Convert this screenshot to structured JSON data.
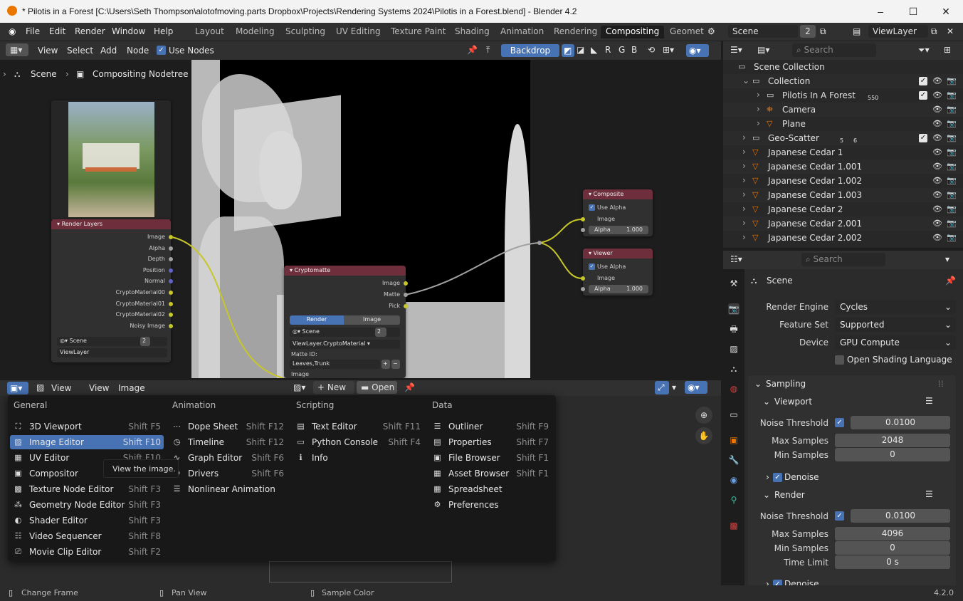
{
  "window": {
    "title": "* Pilotis in a Forest [C:\\Users\\Seth Thompson\\alotofmoving.parts Dropbox\\Projects\\Rendering Systems 2024\\Pilotis in a Forest.blend] - Blender 4.2",
    "minimize": "–",
    "maximize": "☐",
    "close": "✕"
  },
  "menu": [
    "File",
    "Edit",
    "Render",
    "Window",
    "Help"
  ],
  "workspaces": [
    "Layout",
    "Modeling",
    "Sculpting",
    "UV Editing",
    "Texture Paint",
    "Shading",
    "Animation",
    "Rendering",
    "Compositing",
    "Geomet"
  ],
  "scene": {
    "name": "Scene",
    "users": "2",
    "view_layer": "ViewLayer"
  },
  "node_header": {
    "view": "View",
    "select": "Select",
    "add": "Add",
    "node": "Node",
    "use_nodes": "Use Nodes",
    "backdrop": "Backdrop",
    "channels": [
      "R",
      "G",
      "B"
    ]
  },
  "breadcrumb": {
    "scene": "Scene",
    "tree": "Compositing Nodetree"
  },
  "render_layers": {
    "title": "Render Layers",
    "outputs": [
      "Image",
      "Alpha",
      "Depth",
      "Position",
      "Normal",
      "CryptoMaterial00",
      "CryptoMaterial01",
      "CryptoMaterial02",
      "Noisy Image"
    ],
    "scene": "Scene",
    "scene_users": "2",
    "layer": "ViewLayer"
  },
  "cryptomatte": {
    "title": "Cryptomatte",
    "outputs": [
      "Image",
      "Matte",
      "Pick"
    ],
    "tabs": [
      "Render",
      "Image"
    ],
    "scene": "Scene",
    "scene_users": "2",
    "layer": "ViewLayer.CryptoMaterial",
    "matte_label": "Matte ID:",
    "matte_value": "Leaves,Trunk",
    "input_image": "Image"
  },
  "composite": {
    "title": "Composite",
    "use_alpha": "Use Alpha",
    "image": "Image",
    "alpha": "Alpha",
    "alpha_value": "1.000"
  },
  "viewer": {
    "title": "Viewer",
    "use_alpha": "Use Alpha",
    "image": "Image",
    "alpha": "Alpha",
    "alpha_value": "1.000"
  },
  "image_header": {
    "view1": "View",
    "view2": "View",
    "image": "Image",
    "new": "New",
    "open": "Open"
  },
  "editor_menu": {
    "general": {
      "title": "General",
      "items": [
        {
          "label": "3D Viewport",
          "shortcut": "Shift F5"
        },
        {
          "label": "Image Editor",
          "shortcut": "Shift F10"
        },
        {
          "label": "UV Editor",
          "shortcut": "Shift F10"
        },
        {
          "label": "Compositor",
          "shortcut": ""
        },
        {
          "label": "Texture Node Editor",
          "shortcut": "Shift F3"
        },
        {
          "label": "Geometry Node Editor",
          "shortcut": "Shift F3"
        },
        {
          "label": "Shader Editor",
          "shortcut": "Shift F3"
        },
        {
          "label": "Video Sequencer",
          "shortcut": "Shift F8"
        },
        {
          "label": "Movie Clip Editor",
          "shortcut": "Shift F2"
        }
      ]
    },
    "animation": {
      "title": "Animation",
      "items": [
        {
          "label": "Dope Sheet",
          "shortcut": "Shift F12"
        },
        {
          "label": "Timeline",
          "shortcut": "Shift F12"
        },
        {
          "label": "Graph Editor",
          "shortcut": "Shift F6"
        },
        {
          "label": "Drivers",
          "shortcut": "Shift F6"
        },
        {
          "label": "Nonlinear Animation",
          "shortcut": ""
        }
      ]
    },
    "scripting": {
      "title": "Scripting",
      "items": [
        {
          "label": "Text Editor",
          "shortcut": "Shift F11"
        },
        {
          "label": "Python Console",
          "shortcut": "Shift F4"
        },
        {
          "label": "Info",
          "shortcut": ""
        }
      ]
    },
    "data": {
      "title": "Data",
      "items": [
        {
          "label": "Outliner",
          "shortcut": "Shift F9"
        },
        {
          "label": "Properties",
          "shortcut": "Shift F7"
        },
        {
          "label": "File Browser",
          "shortcut": "Shift F1"
        },
        {
          "label": "Asset Browser",
          "shortcut": "Shift F1"
        },
        {
          "label": "Spreadsheet",
          "shortcut": ""
        },
        {
          "label": "Preferences",
          "shortcut": ""
        }
      ]
    },
    "tooltip": "View the image."
  },
  "outliner": {
    "search": "Search",
    "rows": [
      {
        "label": "Scene Collection",
        "icon": "collection"
      },
      {
        "label": "Collection",
        "icon": "collection"
      },
      {
        "label": "Pilotis In A Forest",
        "icon": "collection",
        "badge": "550"
      },
      {
        "label": "Camera",
        "icon": "camera"
      },
      {
        "label": "Plane",
        "icon": "mesh"
      },
      {
        "label": "Geo-Scatter",
        "icon": "collection",
        "badge": "5",
        "badge2": "6"
      },
      {
        "label": "Japanese Cedar 1",
        "icon": "mesh"
      },
      {
        "label": "Japanese Cedar 1.001",
        "icon": "mesh"
      },
      {
        "label": "Japanese Cedar 1.002",
        "icon": "mesh"
      },
      {
        "label": "Japanese Cedar 1.003",
        "icon": "mesh"
      },
      {
        "label": "Japanese Cedar 2",
        "icon": "mesh"
      },
      {
        "label": "Japanese Cedar 2.001",
        "icon": "mesh"
      },
      {
        "label": "Japanese Cedar 2.002",
        "icon": "mesh"
      }
    ]
  },
  "properties": {
    "search": "Search",
    "context": "Scene",
    "render_engine_label": "Render Engine",
    "render_engine": "Cycles",
    "feature_set_label": "Feature Set",
    "feature_set": "Supported",
    "device_label": "Device",
    "device": "GPU Compute",
    "osl": "Open Shading Language",
    "sampling": "Sampling",
    "viewport": "Viewport",
    "noise_threshold_label": "Noise Threshold",
    "vp_noise": "0.0100",
    "max_samples_label": "Max Samples",
    "vp_max": "2048",
    "min_samples_label": "Min Samples",
    "vp_min": "0",
    "denoise": "Denoise",
    "render": "Render",
    "r_noise": "0.0100",
    "r_max": "4096",
    "r_min": "0",
    "time_limit_label": "Time Limit",
    "time_limit": "0 s",
    "denoise2": "Denoise"
  },
  "status": {
    "change_frame": "Change Frame",
    "pan_view": "Pan View",
    "sample_color": "Sample Color",
    "version": "4.2.0"
  },
  "colors": {
    "accent": "#4772b3",
    "render_layers_header": "#6e2e3b",
    "socket_yellow": "#c7c729",
    "socket_blue": "#6363c7",
    "socket_gray": "#a1a1a1",
    "orange": "#ea7600"
  }
}
